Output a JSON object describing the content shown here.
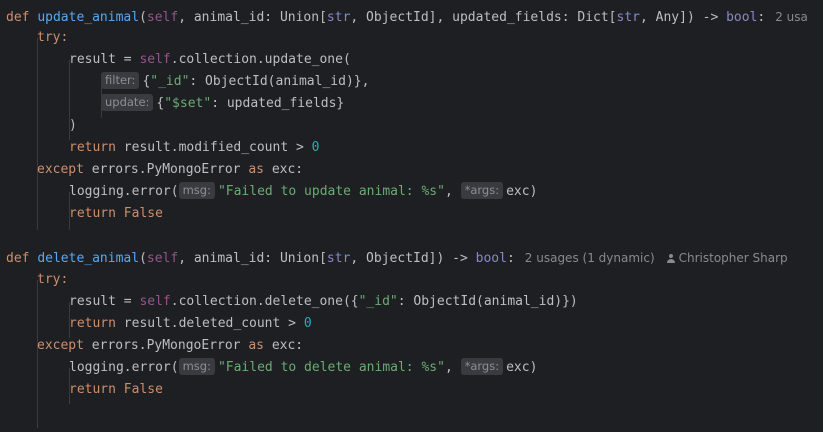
{
  "code": {
    "fn1": {
      "def_kw": "def",
      "name": "update_animal",
      "open_paren": "(",
      "self": "self",
      "param1": ", animal_id: Union[",
      "str1": "str",
      "param1_rest": ", ObjectId], updated_fields: Dict[",
      "str2": "str",
      "param2_rest": ", Any]) -> ",
      "bool": "bool",
      "colon": ":",
      "usages": "2 usa",
      "try_kw": "try:",
      "result_assign": "result = ",
      "self2": "self",
      "collection_call": ".collection.update_one(",
      "filter_hint": "filter:",
      "filter_open": "{",
      "filter_key": "\"_id\"",
      "filter_value": ": ObjectId(animal_id)},",
      "update_hint": "update:",
      "update_open": "{",
      "update_key": "\"$set\"",
      "update_value": ": updated_fields}",
      "close_paren": ")",
      "return_kw": "return",
      "return_expr": " result.modified_count > ",
      "return_num": "0",
      "except_kw": "except",
      "except_expr": " errors.PyMongoError ",
      "as_kw": "as",
      "exc_var": " exc:",
      "log_call": "logging.error(",
      "msg_hint": "msg:",
      "log_msg": "\"Failed to update animal: %s\"",
      "comma": ", ",
      "args_hint": "*args:",
      "log_args": "exc)",
      "return_false_kw": "return",
      "false_kw": " False"
    },
    "fn2": {
      "def_kw": "def",
      "name": "delete_animal",
      "open_paren": "(",
      "self": "self",
      "param1": ", animal_id: Union[",
      "str1": "str",
      "param1_rest": ", ObjectId]) -> ",
      "bool": "bool",
      "colon": ":",
      "usages": "2 usages (1 dynamic)",
      "author": "Christopher Sharp",
      "try_kw": "try:",
      "result_assign": "result = ",
      "self2": "self",
      "collection_call": ".collection.delete_one({",
      "filter_key": "\"_id\"",
      "filter_value": ": ObjectId(animal_id)})",
      "return_kw": "return",
      "return_expr": " result.deleted_count > ",
      "return_num": "0",
      "except_kw": "except",
      "except_expr": " errors.PyMongoError ",
      "as_kw": "as",
      "exc_var": " exc:",
      "log_call": "logging.error(",
      "msg_hint": "msg:",
      "log_msg": "\"Failed to delete animal: %s\"",
      "comma": ", ",
      "args_hint": "*args:",
      "log_args": "exc)",
      "return_false_kw": "return",
      "false_kw": " False"
    }
  },
  "colors": {
    "background": "#1e1f22",
    "keyword": "#cf8e6d",
    "function": "#56a8f5",
    "self": "#94558d",
    "string": "#6aab73",
    "number": "#2aacb8",
    "builtin": "#8888c6",
    "text": "#bcbec4"
  },
  "icons": {
    "author": "person-icon"
  }
}
